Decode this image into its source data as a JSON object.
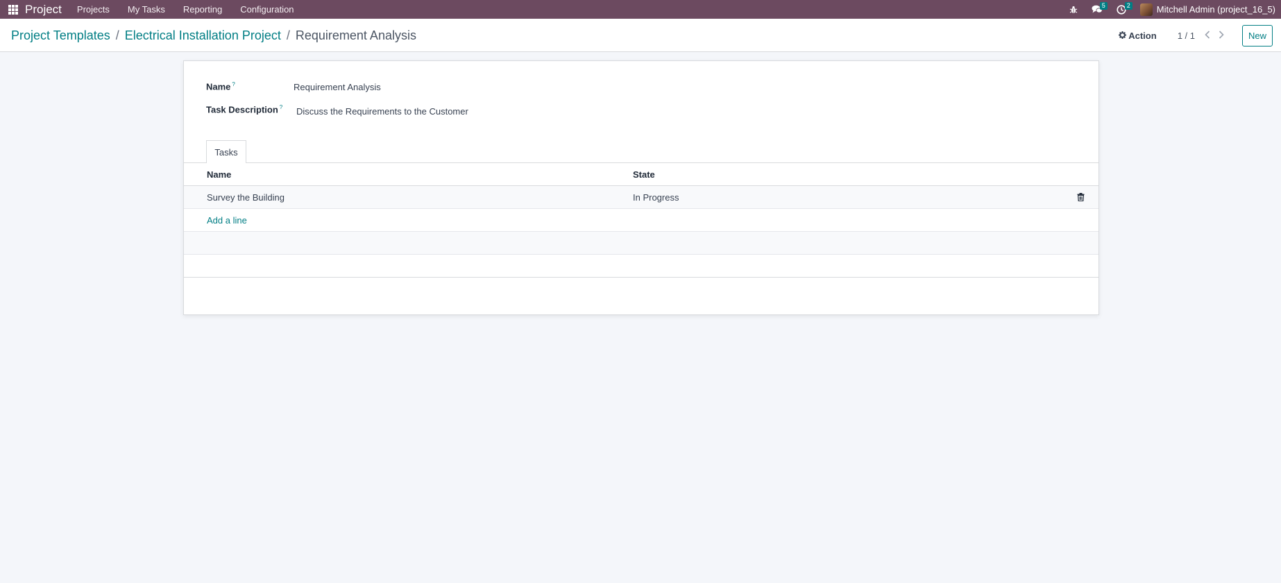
{
  "navbar": {
    "app_name": "Project",
    "menu": [
      "Projects",
      "My Tasks",
      "Reporting",
      "Configuration"
    ],
    "messages_count": "5",
    "activities_count": "2",
    "user": "Mitchell Admin (project_16_5)",
    "icons": [
      "apps-grid-icon",
      "bug-icon",
      "chat-icon",
      "clock-icon"
    ]
  },
  "breadcrumb": {
    "level1": "Project Templates",
    "level2": "Electrical Installation Project",
    "current": "Requirement Analysis",
    "separator": "/"
  },
  "control": {
    "action_label": "Action",
    "pager": "1 / 1",
    "new_label": "New"
  },
  "form": {
    "name_label": "Name",
    "name_value": "Requirement Analysis",
    "desc_label": "Task Description",
    "desc_value": "Discuss the Requirements to the Customer",
    "help_marker": "?"
  },
  "tabs": [
    {
      "label": "Tasks"
    }
  ],
  "tasks_table": {
    "columns": [
      "Name",
      "State"
    ],
    "rows": [
      {
        "name": "Survey the Building",
        "state": "In Progress"
      }
    ],
    "add_line": "Add a line"
  },
  "colors": {
    "navbar": "#6c4a60",
    "accent": "#017e84",
    "background": "#f4f6fa"
  }
}
